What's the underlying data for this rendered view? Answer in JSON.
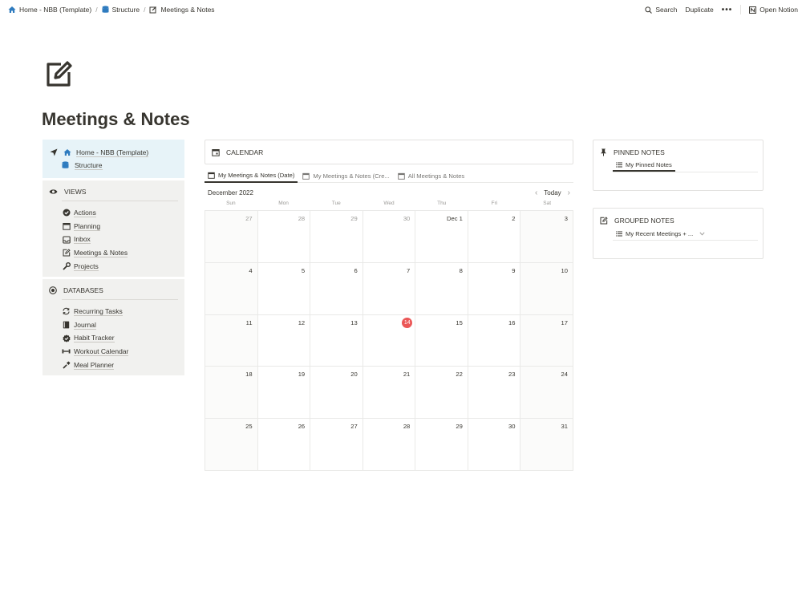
{
  "breadcrumb": {
    "items": [
      "Home - NBB (Template)",
      "Structure",
      "Meetings & Notes"
    ],
    "separator": "/"
  },
  "topbar": {
    "search": "Search",
    "duplicate": "Duplicate",
    "more": "•••",
    "open_notion": "Open Notion"
  },
  "page": {
    "icon": "note-pencil-icon",
    "title": "Meetings & Notes"
  },
  "nav_panel": {
    "items": [
      {
        "label": "Home - NBB (Template)",
        "icon": "home-icon"
      },
      {
        "label": "Structure",
        "icon": "database-icon"
      }
    ]
  },
  "views_panel": {
    "heading": "VIEWS",
    "items": [
      {
        "label": "Actions",
        "icon": "check-circle-icon"
      },
      {
        "label": "Planning",
        "icon": "calendar-icon"
      },
      {
        "label": "Inbox",
        "icon": "inbox-icon"
      },
      {
        "label": "Meetings & Notes",
        "icon": "note-pencil-icon"
      },
      {
        "label": "Projects",
        "icon": "wrench-icon"
      }
    ]
  },
  "databases_panel": {
    "heading": "DATABASES",
    "items": [
      {
        "label": "Recurring Tasks",
        "icon": "repeat-icon"
      },
      {
        "label": "Journal",
        "icon": "book-icon"
      },
      {
        "label": "Habit Tracker",
        "icon": "check-badge-icon"
      },
      {
        "label": "Workout Calendar",
        "icon": "dumbbell-icon"
      },
      {
        "label": "Meal Planner",
        "icon": "chef-icon"
      }
    ]
  },
  "calendar": {
    "heading": "CALENDAR",
    "tabs": [
      "My Meetings & Notes (Date)",
      "My Meetings & Notes (Cre...",
      "All Meetings & Notes"
    ],
    "active_tab": 0,
    "month": "December 2022",
    "today_label": "Today",
    "weekdays": [
      "Sun",
      "Mon",
      "Tue",
      "Wed",
      "Thu",
      "Fri",
      "Sat"
    ],
    "weeks": [
      [
        "27",
        "28",
        "29",
        "30",
        "Dec 1",
        "2",
        "3"
      ],
      [
        "4",
        "5",
        "6",
        "7",
        "8",
        "9",
        "10"
      ],
      [
        "11",
        "12",
        "13",
        "14",
        "15",
        "16",
        "17"
      ],
      [
        "18",
        "19",
        "20",
        "21",
        "22",
        "23",
        "24"
      ],
      [
        "25",
        "26",
        "27",
        "28",
        "29",
        "30",
        "31"
      ]
    ],
    "today": "14"
  },
  "pinned_panel": {
    "heading": "PINNED NOTES",
    "tab": "My Pinned Notes"
  },
  "grouped_panel": {
    "heading": "GROUPED NOTES",
    "tab": "My Recent Meetings + ..."
  },
  "colors": {
    "nav_bg": "#e7f3f8",
    "panel_bg": "#f1f1ef",
    "today": "#eb5757",
    "text": "#37352f"
  }
}
